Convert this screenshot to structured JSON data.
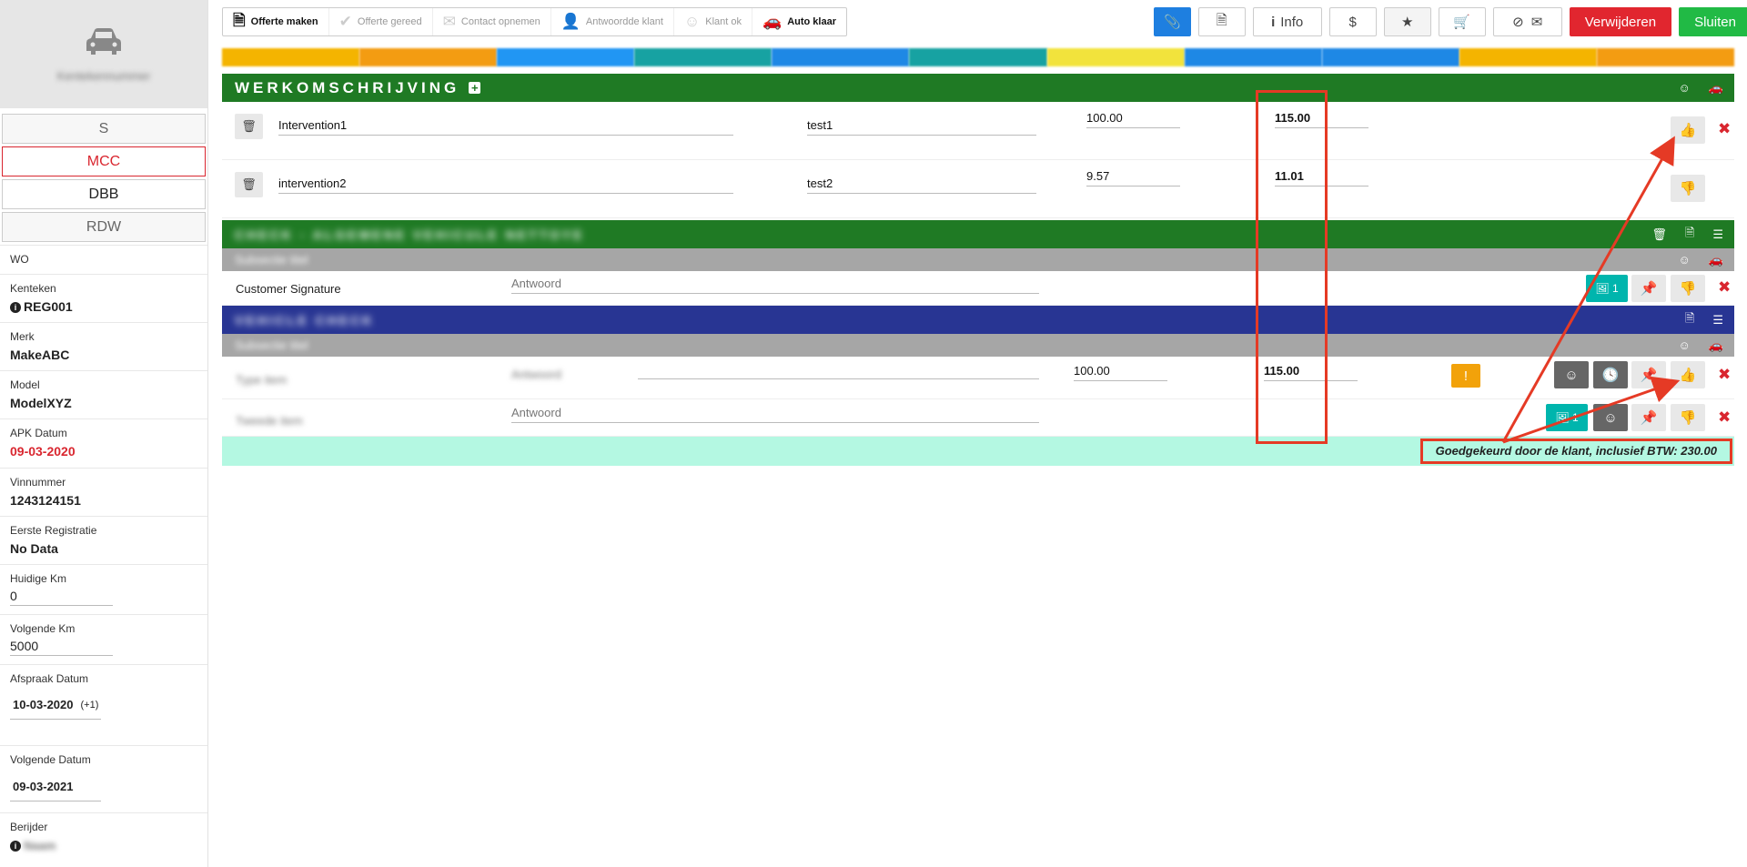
{
  "sidebar": {
    "car_caption": "Kentekennummer",
    "buttons": [
      {
        "label": "S"
      },
      {
        "label": "MCC"
      },
      {
        "label": "DBB"
      },
      {
        "label": "RDW"
      }
    ],
    "fields": [
      {
        "label": "WO",
        "value": ""
      },
      {
        "label": "Kenteken",
        "value": "REG001"
      },
      {
        "label": "Merk",
        "value": "MakeABC"
      },
      {
        "label": "Model",
        "value": "ModelXYZ"
      },
      {
        "label": "APK Datum",
        "value": "09-03-2020"
      },
      {
        "label": "Vinnummer",
        "value": "1243124151"
      },
      {
        "label": "Eerste Registratie",
        "value": "No Data"
      },
      {
        "label": "Huidige Km",
        "value": "0"
      },
      {
        "label": "Volgende Km",
        "value": "5000"
      },
      {
        "label": "Afspraak Datum",
        "value": "10-03-2020",
        "extra": "(+1)"
      },
      {
        "label": "Volgende Datum",
        "value": "09-03-2021"
      },
      {
        "label": "Berijder",
        "value": "Naam"
      }
    ]
  },
  "steps": [
    {
      "label": "Offerte maken"
    },
    {
      "label": "Offerte gereed"
    },
    {
      "label": "Contact opnemen"
    },
    {
      "label": "Antwoordde klant"
    },
    {
      "label": "Klant ok"
    },
    {
      "label": "Auto klaar"
    }
  ],
  "toolbar": {
    "info_label": "Info",
    "dollar_label": "$",
    "delete_label": "Verwijderen",
    "close_label": "Sluiten"
  },
  "colorbar": [
    "#f4b400",
    "#f39c12",
    "#2196f3",
    "#17a2a2",
    "#1e88e5",
    "#17a2a2",
    "#f2e33c",
    "#1e88e5",
    "#1e88e5",
    "#f4b400",
    "#f39c12"
  ],
  "werkomschrijving": {
    "title": "WERKOMSCHRIJVING",
    "rows": [
      {
        "name": "Intervention1",
        "desc": "test1",
        "price": "100.00",
        "price_vat": "115.00"
      },
      {
        "name": "intervention2",
        "desc": "test2",
        "price": "9.57",
        "price_vat": "11.01"
      }
    ]
  },
  "section2": {
    "title": "CHECK - ALGEMENE VEHICULE NETTOYE",
    "subtitle": "Subsectie titel",
    "signature_label": "Customer Signature",
    "answer_placeholder": "Antwoord",
    "photo_count": "1"
  },
  "section3": {
    "title": "VEHICLE CHECK",
    "subtitle": "Subsectie titel",
    "rows": [
      {
        "name": "Type item",
        "answer": "Antwoord",
        "price": "100.00",
        "price_vat": "115.00"
      },
      {
        "name": "Tweede item",
        "answer": "Antwoord",
        "photo_count": "1"
      }
    ]
  },
  "total_text": "Goedgekeurd door de klant, inclusief BTW: 230.00"
}
